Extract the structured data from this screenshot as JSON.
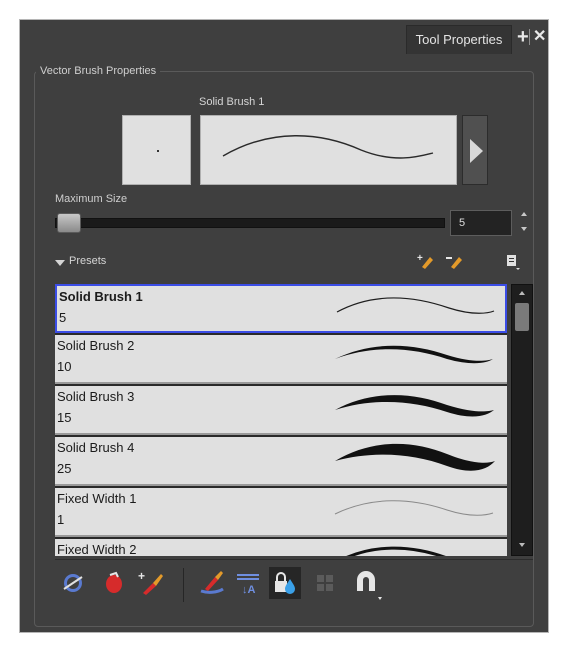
{
  "window": {
    "tab_label": "Tool Properties",
    "add_icon": "plus-icon",
    "close_icon": "close-icon"
  },
  "properties": {
    "group_title": "Vector Brush Properties",
    "brush_name": "Solid Brush 1",
    "max_size_label": "Maximum Size",
    "max_size_value": "5",
    "max_size_slider_fraction": 0.03
  },
  "presets": {
    "label": "Presets",
    "actions": [
      "new-preset-icon",
      "rename-preset-icon",
      "presets-menu-icon"
    ],
    "items": [
      {
        "name": "Solid Brush 1",
        "size": "5",
        "selected": true
      },
      {
        "name": "Solid Brush 2",
        "size": "10"
      },
      {
        "name": "Solid Brush 3",
        "size": "15"
      },
      {
        "name": "Solid Brush 4",
        "size": "25"
      },
      {
        "name": "Fixed Width 1",
        "size": "1"
      },
      {
        "name": "Fixed Width 2",
        "size": ""
      }
    ]
  },
  "toolbar": {
    "buttons": [
      "trim-ball-icon",
      "paint-bucket-icon",
      "brush-plus-icon",
      "smooth-brush-icon",
      "auto-flatten-icon",
      "lock-color-icon",
      "grid-icon",
      "magnet-icon"
    ],
    "active": "lock-color-icon"
  },
  "colors": {
    "panel_bg": "#3f3f3f",
    "selection_border": "#3b4de6",
    "list_bg": "#e0e0e0"
  }
}
